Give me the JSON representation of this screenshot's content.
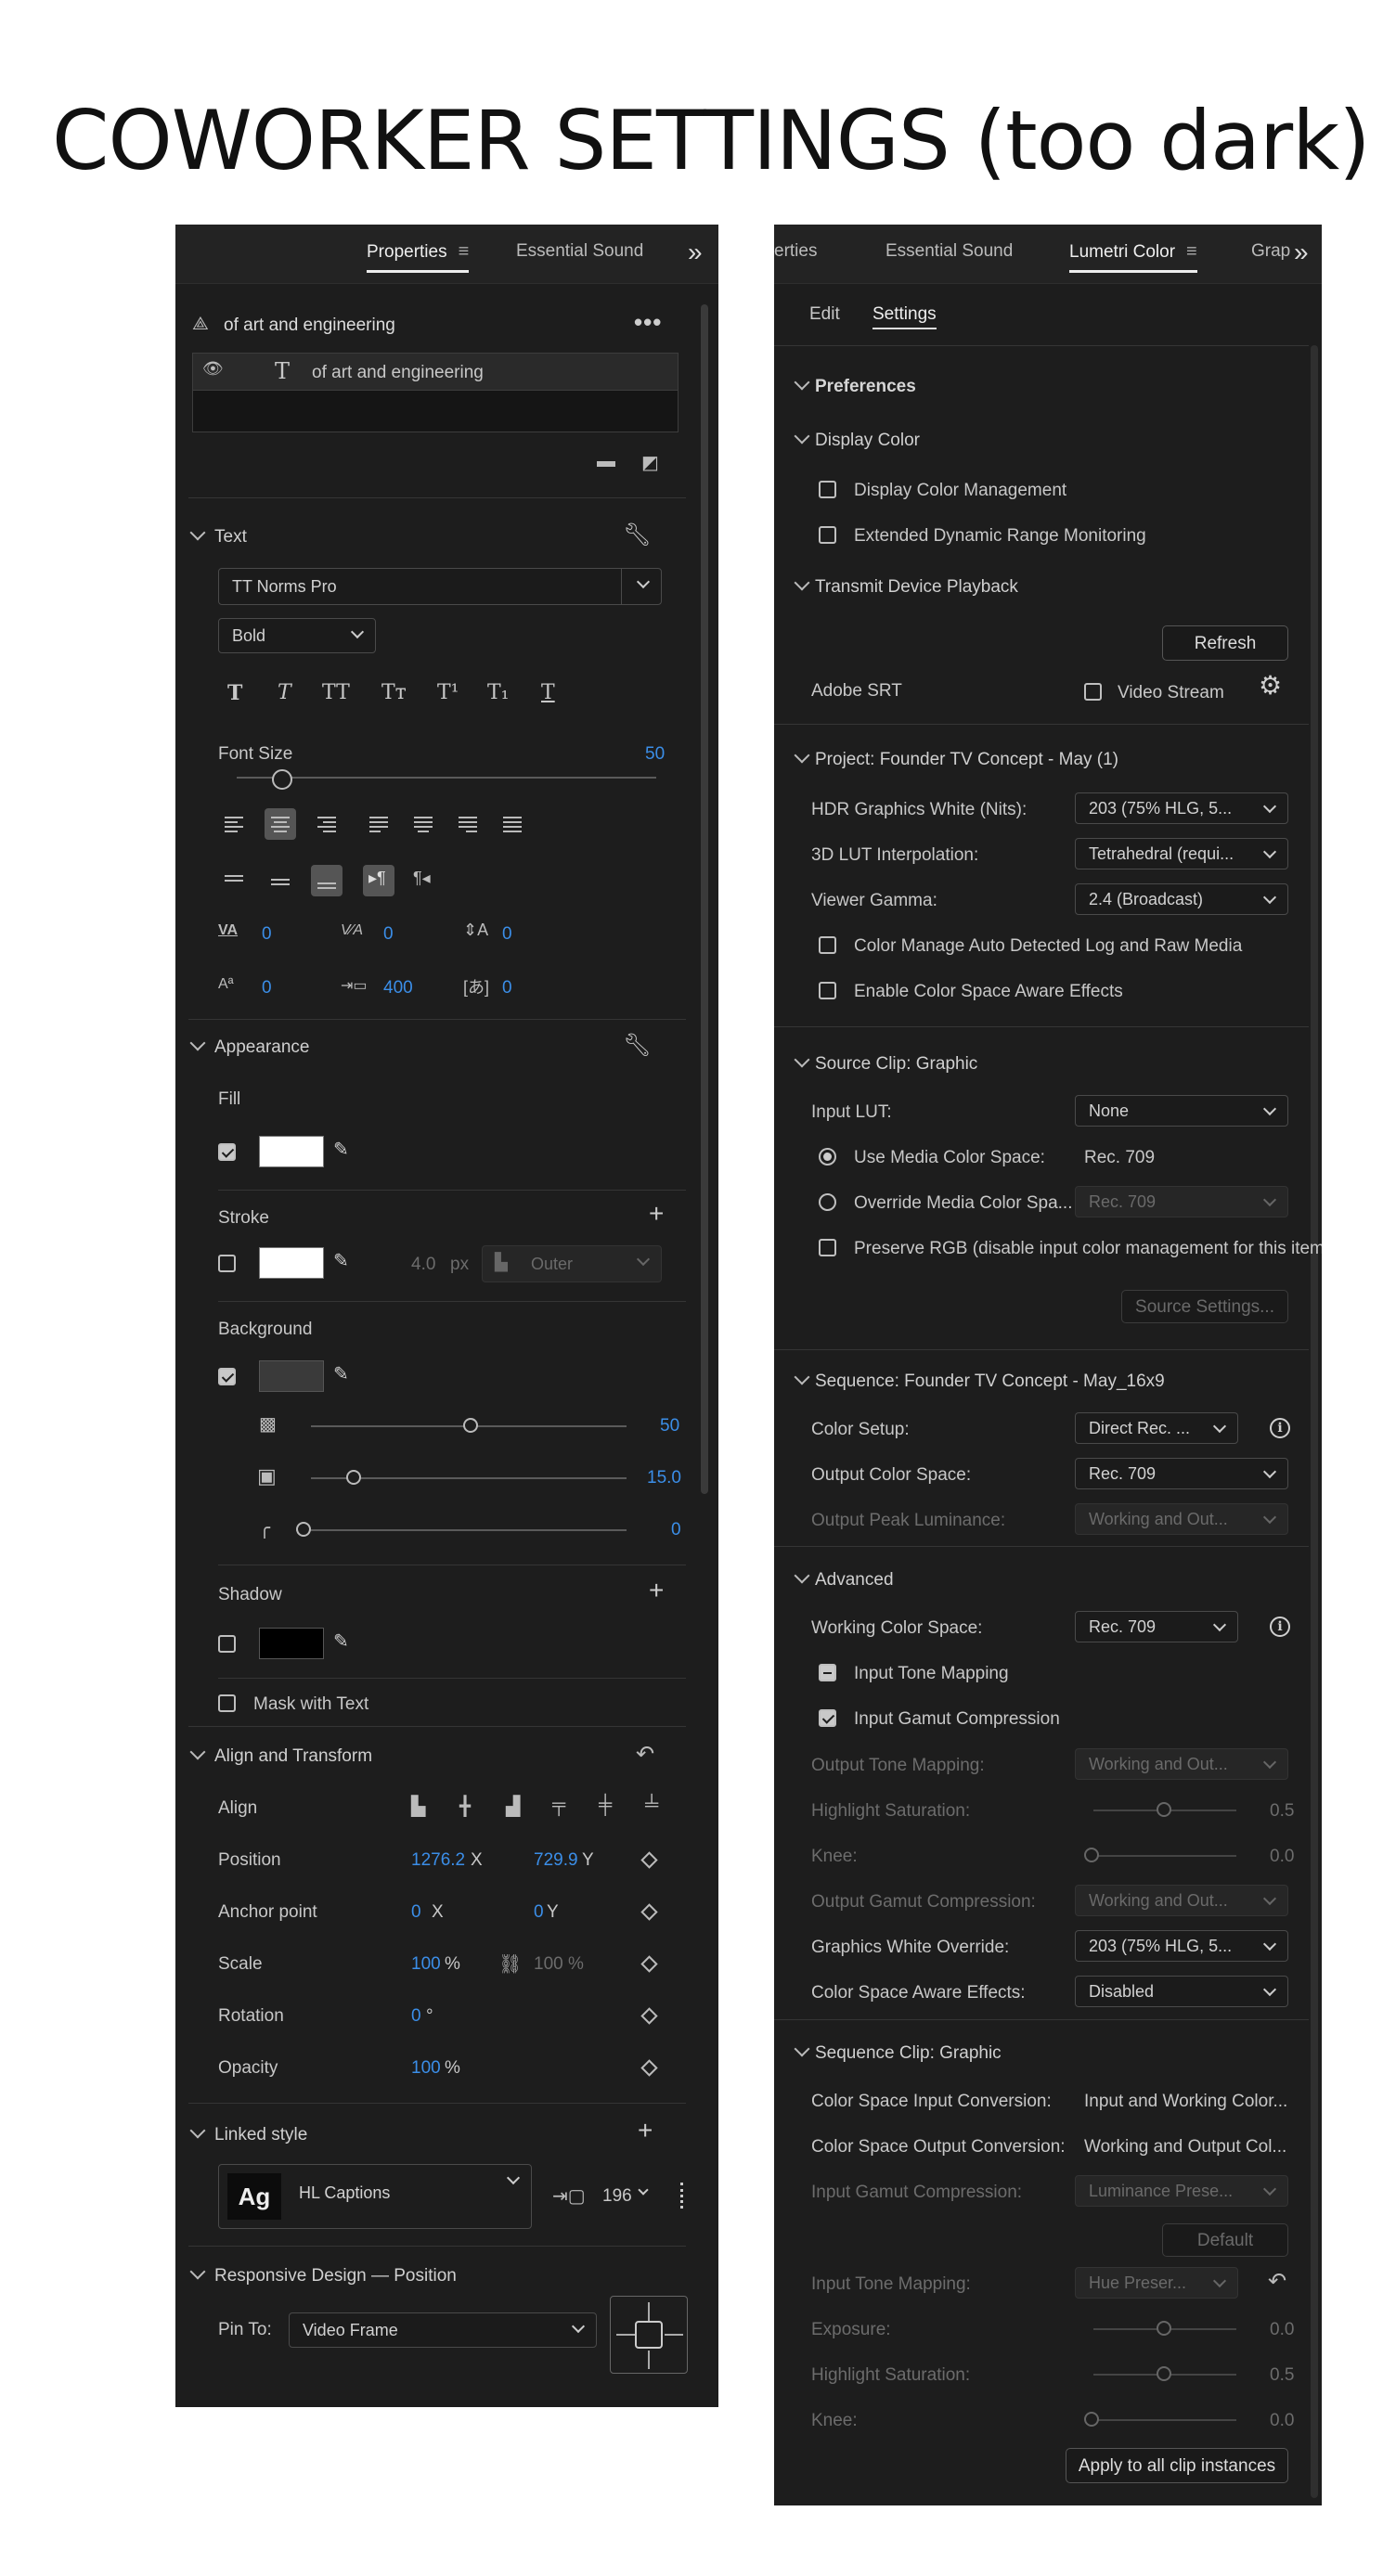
{
  "heading": "COWORKER SETTINGS (too dark)",
  "left": {
    "tabs": {
      "properties": "Properties",
      "menu": "≡",
      "sound": "Essential Sound",
      "overflow": "»"
    },
    "layer": {
      "title": "of art and engineering",
      "more": "•••",
      "item": "of art and engineering",
      "item_icon": "T"
    },
    "text": {
      "header": "Text",
      "font": "TT Norms Pro",
      "weight": "Bold",
      "fmt": [
        "T",
        "T",
        "TT",
        "Tт",
        "T¹",
        "T₁",
        "T"
      ],
      "font_size_label": "Font Size",
      "font_size": "50",
      "kern": "0",
      "track": "0",
      "lead": "0",
      "baseline": "0",
      "tab": "400",
      "tsume": "0"
    },
    "appearance": {
      "header": "Appearance",
      "fill": "Fill",
      "stroke": "Stroke",
      "stroke_width": "4.0",
      "stroke_unit": "px",
      "stroke_pos": "Outer",
      "background": "Background",
      "bg_opacity": "50",
      "bg_size": "15.0",
      "bg_corner": "0",
      "shadow": "Shadow",
      "mask": "Mask with Text",
      "fill_checked": true,
      "stroke_checked": false,
      "bg_checked": true,
      "shadow_checked": false,
      "mask_checked": false
    },
    "transform": {
      "header": "Align and Transform",
      "align": "Align",
      "position_label": "Position",
      "pos_x": "1276.2",
      "pos_x_unit": "X",
      "pos_y": "729.9",
      "pos_y_unit": "Y",
      "anchor_label": "Anchor point",
      "anchor_x": "0",
      "anchor_x_unit": "X",
      "anchor_y": "0",
      "anchor_y_unit": "Y",
      "scale_label": "Scale",
      "scale": "100",
      "scale_unit": "%",
      "scale2": "100 %",
      "rotation_label": "Rotation",
      "rotation": "0",
      "rotation_unit": "°",
      "opacity_label": "Opacity",
      "opacity": "100",
      "opacity_unit": "%"
    },
    "linked": {
      "header": "Linked style",
      "ag": "Ag",
      "style": "HL Captions",
      "count": "196"
    },
    "responsive": {
      "header": "Responsive Design — Position",
      "pin_label": "Pin To:",
      "pin_value": "Video Frame"
    }
  },
  "right": {
    "tabs": {
      "props": "erties",
      "sound": "Essential Sound",
      "lumetri": "Lumetri Color",
      "menu": "≡",
      "graphics": "Grap",
      "overflow": "»"
    },
    "subtabs": {
      "edit": "Edit",
      "settings": "Settings"
    },
    "preferences": "Preferences",
    "display_color": "Display Color",
    "display_mgmt": "Display Color Management",
    "hdr_monitor": "Extended Dynamic Range Monitoring",
    "transmit": "Transmit Device Playback",
    "refresh": "Refresh",
    "adobe_srt": "Adobe SRT",
    "video_stream": "Video Stream",
    "project_label": "Project:",
    "project_name": "Founder TV Concept - May (1)",
    "hdr_white_label": "HDR Graphics White (Nits):",
    "hdr_white": "203 (75% HLG, 5...",
    "lut_interp_label": "3D LUT Interpolation:",
    "lut_interp": "Tetrahedral (requi...",
    "viewer_gamma_label": "Viewer Gamma:",
    "viewer_gamma": "2.4 (Broadcast)",
    "cm_auto": "Color Manage Auto Detected Log and Raw Media",
    "cs_aware": "Enable Color Space Aware Effects",
    "source_clip_label": "Source Clip:",
    "source_clip_name": "Graphic",
    "input_lut_label": "Input LUT:",
    "input_lut": "None",
    "use_media_cs": "Use Media Color Space:",
    "use_media_cs_val": "Rec. 709",
    "override_cs": "Override Media Color Spa...",
    "override_cs_val": "Rec. 709",
    "preserve_rgb": "Preserve RGB (disable input color management for this item",
    "source_settings": "Source Settings...",
    "sequence_label": "Sequence:",
    "sequence_name": "Founder TV Concept - May_16x9",
    "color_setup_label": "Color Setup:",
    "color_setup": "Direct Rec. ...",
    "output_cs_label": "Output Color Space:",
    "output_cs": "Rec. 709",
    "output_peak_label": "Output Peak Luminance:",
    "output_peak": "Working and Out...",
    "advanced": "Advanced",
    "working_cs_label": "Working Color Space:",
    "working_cs": "Rec. 709",
    "input_tone": "Input Tone Mapping",
    "input_gamut": "Input Gamut Compression",
    "out_tone_label": "Output Tone Mapping:",
    "out_tone": "Working and Out...",
    "hl_sat_label": "Highlight Saturation:",
    "hl_sat": "0.5",
    "knee_label": "Knee:",
    "knee": "0.0",
    "out_gamut_label": "Output Gamut Compression:",
    "out_gamut": "Working and Out...",
    "gfx_white_label": "Graphics White Override:",
    "gfx_white": "203 (75% HLG, 5...",
    "cs_aware_fx_label": "Color Space Aware Effects:",
    "cs_aware_fx": "Disabled",
    "seq_clip_label": "Sequence Clip:",
    "seq_clip_name": "Graphic",
    "cs_in_conv_label": "Color Space Input Conversion:",
    "cs_in_conv": "Input and Working Color...",
    "cs_out_conv_label": "Color Space Output Conversion:",
    "cs_out_conv": "Working and Output Col...",
    "in_gamut_label": "Input Gamut Compression:",
    "in_gamut": "Luminance Prese...",
    "default": "Default",
    "in_tone_label": "Input Tone Mapping:",
    "in_tone": "Hue Preser...",
    "exposure_label": "Exposure:",
    "exposure": "0.0",
    "hl_sat2_label": "Highlight Saturation:",
    "hl_sat2": "0.5",
    "knee2_label": "Knee:",
    "knee2": "0.0",
    "apply_all": "Apply to all clip instances"
  }
}
